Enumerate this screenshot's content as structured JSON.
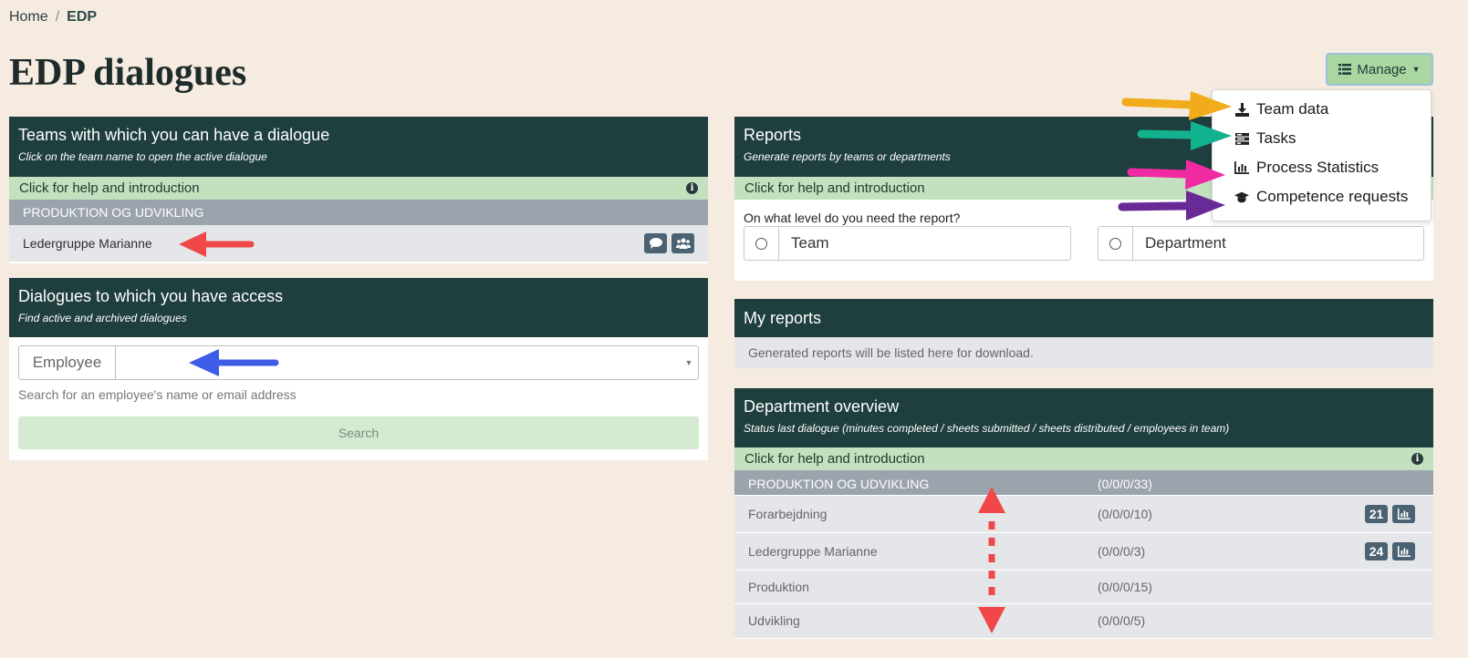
{
  "breadcrumb": {
    "home": "Home",
    "separator": "/",
    "current": "EDP"
  },
  "page_title": "EDP dialogues",
  "manage": {
    "label": "Manage",
    "items": [
      {
        "label": "Team data",
        "icon": "download-icon"
      },
      {
        "label": "Tasks",
        "icon": "tasks-icon"
      },
      {
        "label": "Process Statistics",
        "icon": "bar-chart-icon"
      },
      {
        "label": "Competence requests",
        "icon": "graduation-cap-icon"
      }
    ]
  },
  "teams_panel": {
    "title": "Teams with which you can have a dialogue",
    "subtitle": "Click on the team name to open the active dialogue",
    "help": "Click for help and introduction",
    "group": "PRODUKTION OG UDVIKLING",
    "team": "Ledergruppe Marianne"
  },
  "dialogues_panel": {
    "title": "Dialogues to which you have access",
    "subtitle": "Find active and archived dialogues",
    "field_label": "Employee",
    "field_value": "",
    "hint": "Search for an employee's name or email address",
    "search_button": "Search"
  },
  "reports_panel": {
    "title": "Reports",
    "subtitle": "Generate reports by teams or departments",
    "help": "Click for help and introduction",
    "question": "On what level do you need the report?",
    "options": [
      "Team",
      "Department"
    ]
  },
  "my_reports": {
    "title": "My reports",
    "empty": "Generated reports will be listed here for download."
  },
  "dept_overview": {
    "title": "Department overview",
    "subtitle": "Status last dialogue (minutes completed / sheets submitted / sheets distributed / employees in team)",
    "help": "Click for help and introduction",
    "group": {
      "name": "PRODUKTION OG UDVIKLING",
      "stat": "(0/0/0/33)"
    },
    "rows": [
      {
        "name": "Forarbejdning",
        "stat": "(0/0/0/10)",
        "badge": "21"
      },
      {
        "name": "Ledergruppe Marianne",
        "stat": "(0/0/0/3)",
        "badge": "24"
      },
      {
        "name": "Produktion",
        "stat": "(0/0/0/15)",
        "badge": ""
      },
      {
        "name": "Udvikling",
        "stat": "(0/0/0/5)",
        "badge": ""
      }
    ]
  },
  "colors": {
    "header": "#1f3e3e",
    "help_bar": "#c3e1bf",
    "group_row": "#9ba3ad",
    "background": "#f5ebe0",
    "arrow_red": "#f04848",
    "arrow_blue": "#3d5ce8",
    "arrow_orange": "#f2ab1a",
    "arrow_teal": "#12b28e",
    "arrow_pink": "#f02aa2",
    "arrow_purple": "#6a2a96"
  }
}
